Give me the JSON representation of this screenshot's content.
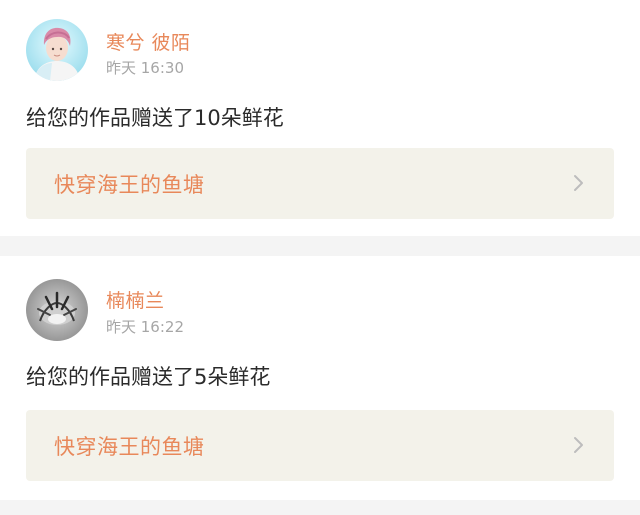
{
  "notifications": [
    {
      "username": "寒兮 彼陌",
      "time": "昨天 16:30",
      "message": "给您的作品赠送了10朵鲜花",
      "work_title": "快穿海王的鱼塘",
      "avatar_icon": "user-avatar-icon"
    },
    {
      "username": "楠楠兰",
      "time": "昨天 16:22",
      "message": "给您的作品赠送了5朵鲜花",
      "work_title": "快穿海王的鱼塘",
      "avatar_icon": "user-avatar-icon"
    }
  ],
  "colors": {
    "accent": "#e8885a",
    "timestamp": "#a6a6a6",
    "link_card_bg": "#f3f2ea",
    "separator": "#f4f4f4"
  }
}
